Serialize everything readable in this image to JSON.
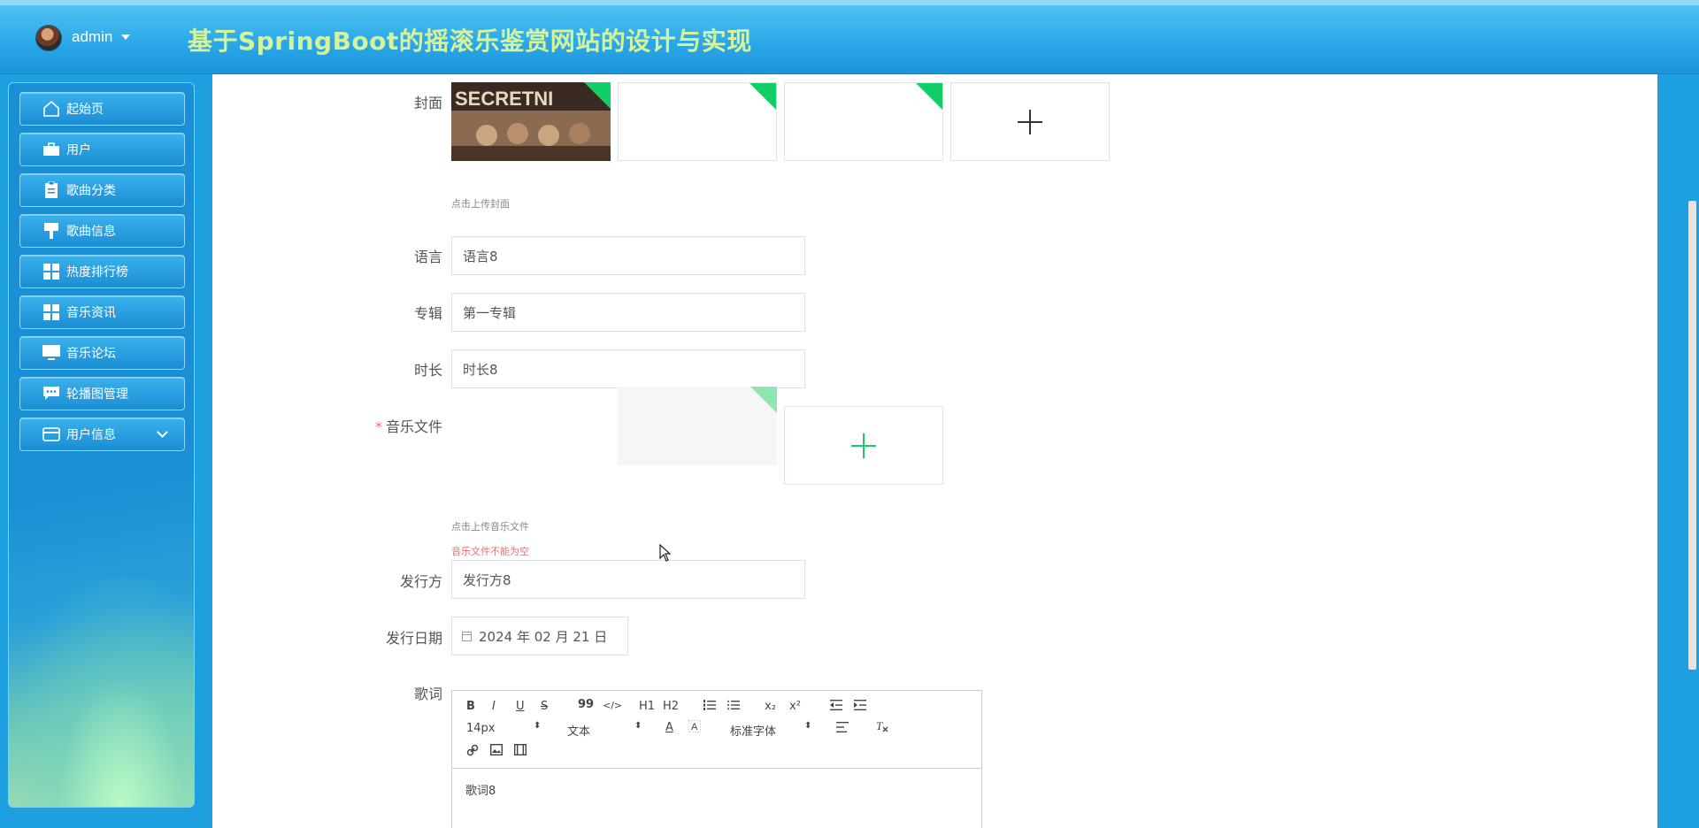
{
  "header": {
    "user": "admin",
    "title": "基于SpringBoot的摇滚乐鉴赏网站的设计与实现"
  },
  "sidebar": {
    "items": [
      {
        "label": "起始页",
        "icon": "home-icon"
      },
      {
        "label": "用户",
        "icon": "briefcase-icon"
      },
      {
        "label": "歌曲分类",
        "icon": "clipboard-icon"
      },
      {
        "label": "歌曲信息",
        "icon": "brush-icon"
      },
      {
        "label": "热度排行榜",
        "icon": "grid-icon"
      },
      {
        "label": "音乐资讯",
        "icon": "grid-icon"
      },
      {
        "label": "音乐论坛",
        "icon": "monitor-icon"
      },
      {
        "label": "轮播图管理",
        "icon": "chat-icon"
      },
      {
        "label": "用户信息",
        "icon": "card-icon"
      }
    ]
  },
  "form": {
    "cover": {
      "label": "封面",
      "hint": "点击上传封面"
    },
    "language": {
      "label": "语言",
      "value": "语言8"
    },
    "album": {
      "label": "专辑",
      "value": "第一专辑"
    },
    "duration": {
      "label": "时长",
      "value": "时长8"
    },
    "music_file": {
      "label": "音乐文件",
      "required_mark": "*",
      "hint": "点击上传音乐文件",
      "error": "音乐文件不能为空"
    },
    "publisher": {
      "label": "发行方",
      "value": "发行方8"
    },
    "release_date": {
      "label": "发行日期",
      "value": "2024 年 02 月 21 日"
    },
    "lyrics": {
      "label": "歌词",
      "content": "歌词8",
      "toolbar": {
        "bold": "B",
        "italic": "I",
        "underline": "U",
        "strike": "S",
        "quote": "99",
        "code": "</>",
        "h1": "H1",
        "h2": "H2",
        "sub": "x₂",
        "sup": "x²",
        "size": "14px",
        "text_type": "文本",
        "font": "标准字体",
        "color": "A"
      }
    }
  },
  "colors": {
    "accent": "#13ce66",
    "error": "#f56c6c",
    "title": "#d6f39a"
  }
}
